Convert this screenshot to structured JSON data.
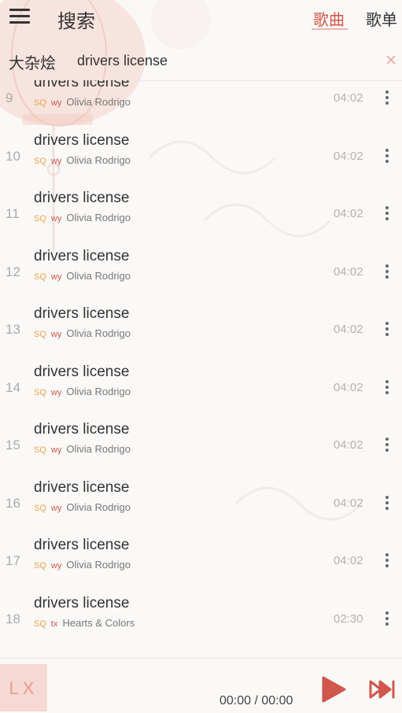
{
  "header": {
    "title": "搜索",
    "tabs": [
      {
        "label": "歌曲",
        "active": true
      },
      {
        "label": "歌单",
        "active": false
      }
    ]
  },
  "search": {
    "source_label": "大杂烩",
    "query": "drivers license"
  },
  "songs": [
    {
      "index": "9",
      "name": "drivers license",
      "quality": "SQ",
      "source": "wy",
      "artist": "Olivia Rodrigo",
      "duration": "04:02"
    },
    {
      "index": "10",
      "name": "drivers license",
      "quality": "SQ",
      "source": "wy",
      "artist": "Olivia Rodrigo",
      "duration": "04:02"
    },
    {
      "index": "11",
      "name": "drivers license",
      "quality": "SQ",
      "source": "wy",
      "artist": "Olivia Rodrigo",
      "duration": "04:02"
    },
    {
      "index": "12",
      "name": "drivers license",
      "quality": "SQ",
      "source": "wy",
      "artist": "Olivia Rodrigo",
      "duration": "04:02"
    },
    {
      "index": "13",
      "name": "drivers license",
      "quality": "SQ",
      "source": "wy",
      "artist": "Olivia Rodrigo",
      "duration": "04:02"
    },
    {
      "index": "14",
      "name": "drivers license",
      "quality": "SQ",
      "source": "wy",
      "artist": "Olivia Rodrigo",
      "duration": "04:02"
    },
    {
      "index": "15",
      "name": "drivers license",
      "quality": "SQ",
      "source": "wy",
      "artist": "Olivia Rodrigo",
      "duration": "04:02"
    },
    {
      "index": "16",
      "name": "drivers license",
      "quality": "SQ",
      "source": "wy",
      "artist": "Olivia Rodrigo",
      "duration": "04:02"
    },
    {
      "index": "17",
      "name": "drivers license",
      "quality": "SQ",
      "source": "wy",
      "artist": "Olivia Rodrigo",
      "duration": "04:02"
    },
    {
      "index": "18",
      "name": "drivers license",
      "quality": "SQ",
      "source": "tx",
      "artist": "Hearts & Colors",
      "duration": "02:30"
    }
  ],
  "player": {
    "cover_text": "LX",
    "time": "00:00 / 00:00"
  },
  "icons": {
    "menu": "menu-icon",
    "clear": "close-icon",
    "more": "more-vertical-icon",
    "play": "play-icon",
    "next": "skip-next-icon"
  },
  "colors": {
    "accent": "#d0574b",
    "quality": "#e6a34a",
    "background": "#fbf9f7"
  }
}
